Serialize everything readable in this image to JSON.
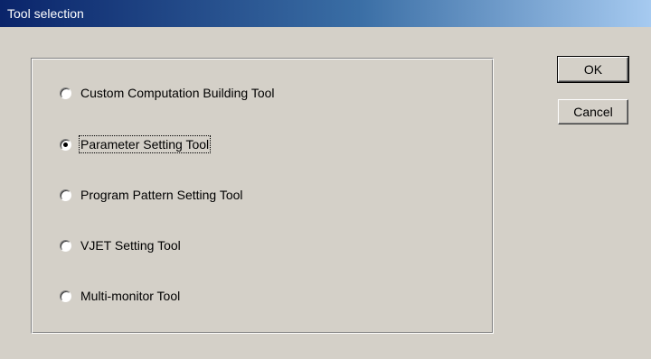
{
  "window": {
    "title": "Tool selection"
  },
  "options": [
    {
      "label": "Custom Computation Building Tool",
      "checked": false
    },
    {
      "label": "Parameter Setting Tool",
      "checked": true
    },
    {
      "label": "Program Pattern Setting Tool",
      "checked": false
    },
    {
      "label": "VJET Setting Tool",
      "checked": false
    },
    {
      "label": "Multi-monitor Tool",
      "checked": false
    }
  ],
  "buttons": {
    "ok": "OK",
    "cancel": "Cancel"
  }
}
